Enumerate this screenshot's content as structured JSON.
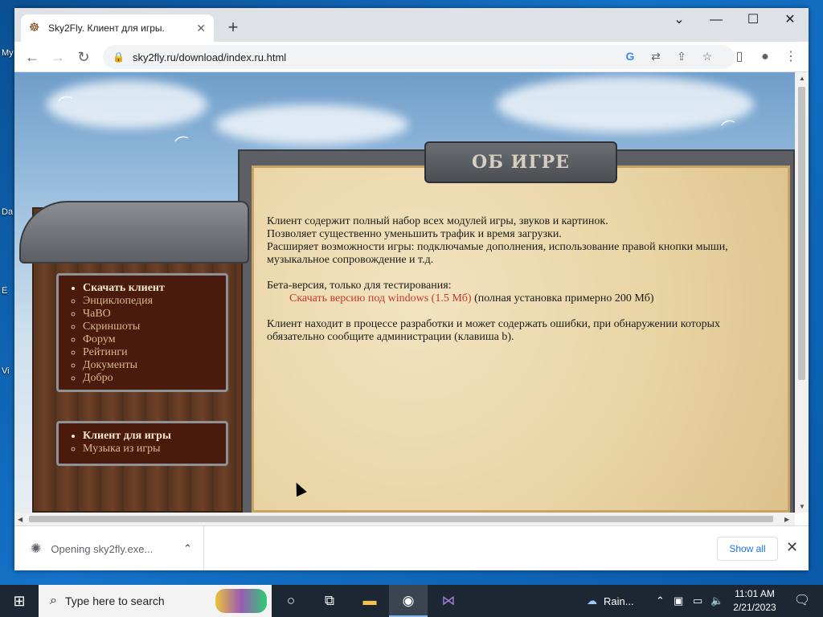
{
  "desktop": {
    "labels": [
      "My",
      "Da",
      "E",
      "Vi"
    ]
  },
  "browser": {
    "tab_title": "Sky2Fly. Клиент для игры.",
    "tab_favicon": "ship-wheel-icon",
    "url": "sky2fly.ru/download/index.ru.html"
  },
  "page": {
    "plaque_title": "ОБ ИГРЕ",
    "para1_line1": "Клиент содержит полный набор всех модулей игры, звуков и картинок.",
    "para1_line2": "Позволяет существенно уменьшить трафик и время загрузки.",
    "para1_line3": "Расширяет возможности игры: подключамые дополнения, использование правой кнопки мыши, музыкальное сопровождение и т.д.",
    "beta_label": "Бета-версия, только для тестирования:",
    "download_link": "Скачать версию под windows (1.5 Мб)",
    "download_note": " (полная установка примерно 200 Мб)",
    "para3": "Клиент находит в процессе разработки и может содержать ошибки, при обнаружении которых обязательно сообщите администрации (клавиша b).",
    "menu_main": [
      "Скачать клиент",
      "Энциклопедия",
      "ЧаВО",
      "Скриншоты",
      "Форум",
      "Рейтинги",
      "Документы",
      "Добро"
    ],
    "menu_sub": [
      "Клиент для игры",
      "Музыка из игры"
    ]
  },
  "downloads": {
    "item_text": "Opening sky2fly.exe...",
    "show_all": "Show all"
  },
  "taskbar": {
    "search_placeholder": "Type here to search",
    "weather": "Rain...",
    "time": "11:01 AM",
    "date": "2/21/2023"
  }
}
